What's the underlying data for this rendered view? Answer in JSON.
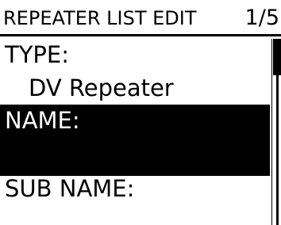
{
  "header": {
    "title": "REPEATER LIST EDIT",
    "page": "1/5"
  },
  "items": [
    {
      "label": "TYPE:",
      "value": "DV Repeater",
      "selected": false
    },
    {
      "label": "NAME:",
      "value": "",
      "selected": true
    },
    {
      "label": "SUB NAME:",
      "value": "",
      "selected": false
    }
  ],
  "scrollbar": {
    "position": 0.0
  },
  "colors": {
    "background": "#ffffff",
    "foreground": "#000000",
    "highlight": "#000000"
  }
}
